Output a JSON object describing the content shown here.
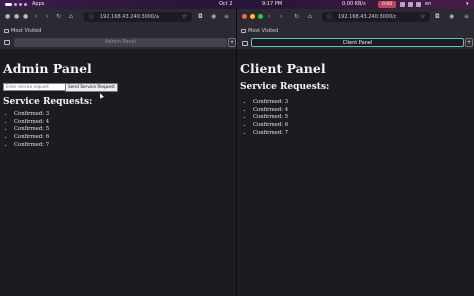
{
  "system_bar": {
    "apps_label": "Apps",
    "date": "Oct 2",
    "time": "9:17 PM",
    "net_speed": "0.00 KB/s",
    "recording": "0:00",
    "keyboard_layout": "en"
  },
  "left_window": {
    "url": "192.168.43.240:3000/a",
    "bookmarks_label": "Most Visited",
    "tab_title": "Admin Panel",
    "page": {
      "heading": "Admin Panel",
      "input_placeholder": "Enter service request",
      "send_button": "Send Service Request",
      "section_heading": "Service Requests:",
      "items": [
        "Confirmed: 3",
        "Confirmed: 4",
        "Confirmed: 5",
        "Confirmed: 6",
        "Confirmed: 7"
      ]
    }
  },
  "right_window": {
    "url": "192.168.43.240:3000/c",
    "bookmarks_label": "Most Visited",
    "tab_title": "Client Panel",
    "page": {
      "heading": "Client Panel",
      "section_heading": "Service Requests:",
      "items": [
        "Confirmed: 3",
        "Confirmed: 4",
        "Confirmed: 5",
        "Confirmed: 6",
        "Confirmed: 7"
      ]
    }
  },
  "colors": {
    "accent_tab_border": "#57c7b0",
    "toolbar_bg": "#2b2a33",
    "page_bg": "#1c1b22",
    "recording_badge": "#c0455c"
  }
}
